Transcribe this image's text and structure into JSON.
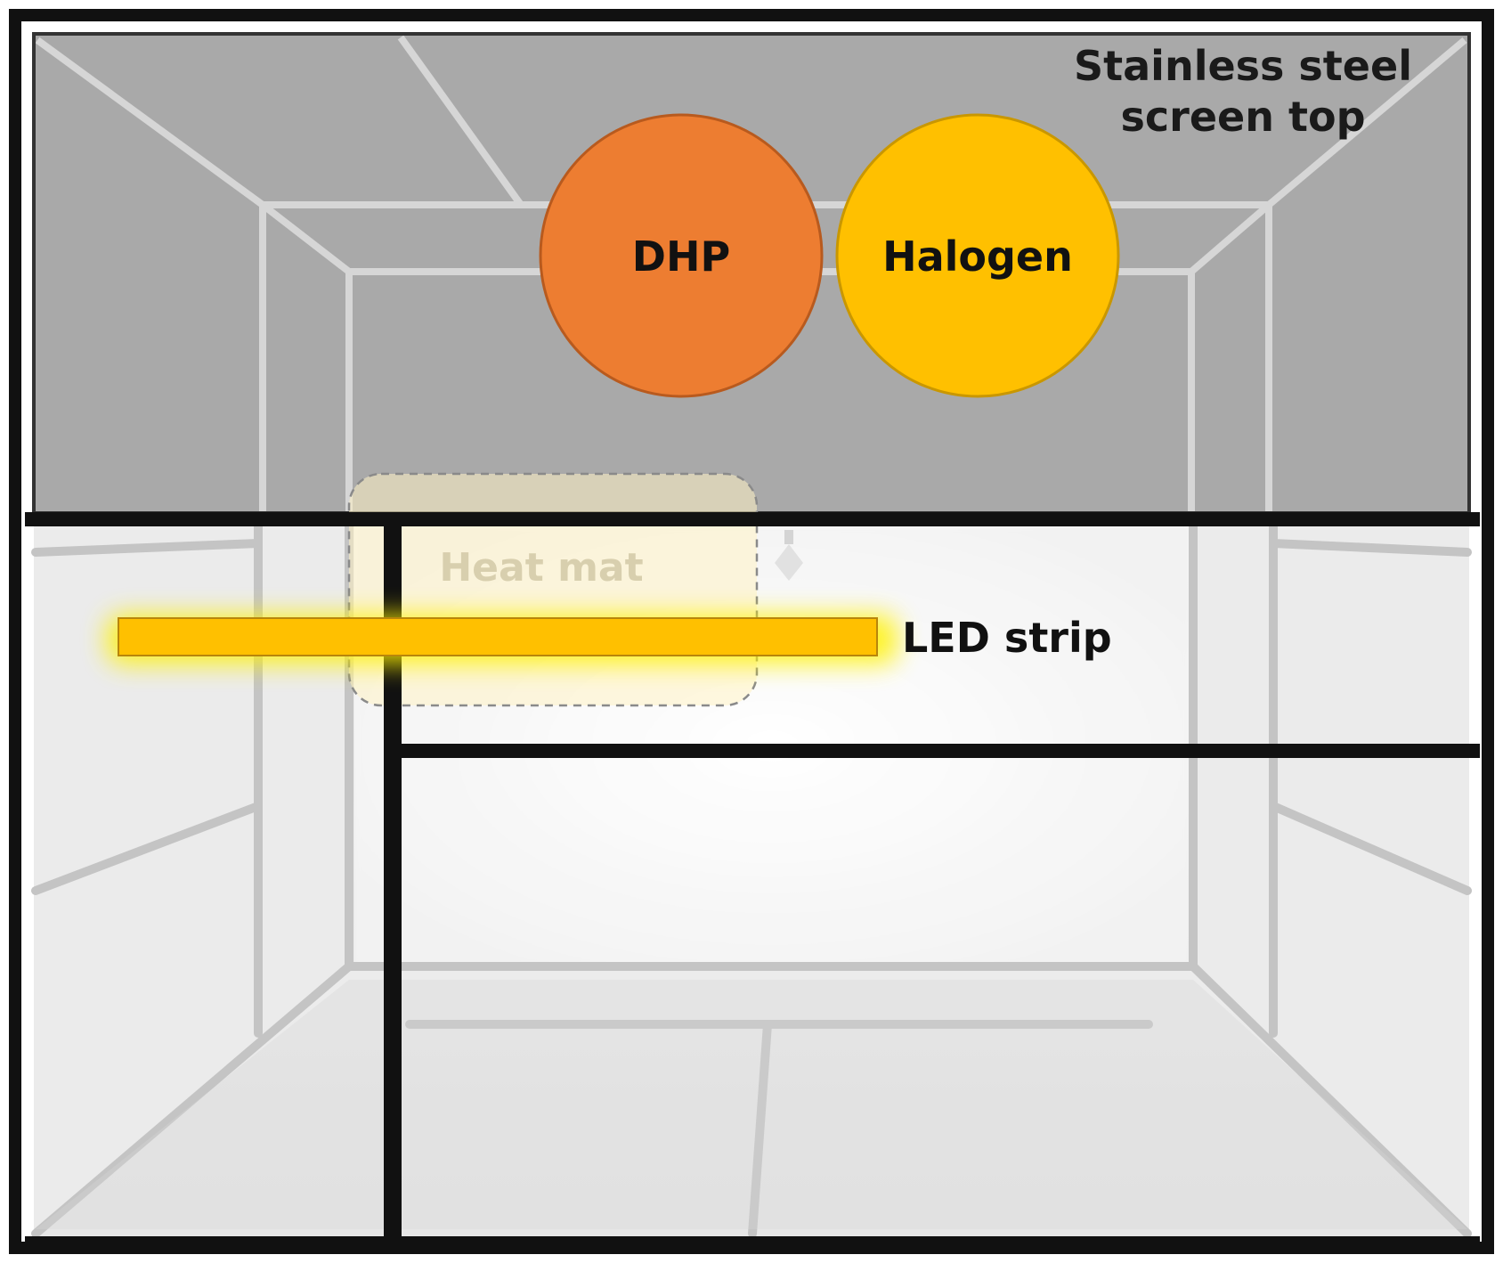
{
  "labels": {
    "screen_top_line1": "Stainless steel",
    "screen_top_line2": "screen top",
    "heater_1": "DHP",
    "heater_2": "Halogen",
    "heat_mat": "Heat mat",
    "led_strip": "LED strip"
  },
  "colors": {
    "dhp_fill": "#ED7D31",
    "dhp_stroke": "#B85A1E",
    "halogen_fill": "#FFC000",
    "halogen_stroke": "#C99700",
    "led_fill": "#FFC000",
    "led_glow": "#FFF200",
    "heat_mat_fill": "#FFF2C4",
    "screen_top_fill": "#A8A8A8",
    "frame": "#111111"
  }
}
